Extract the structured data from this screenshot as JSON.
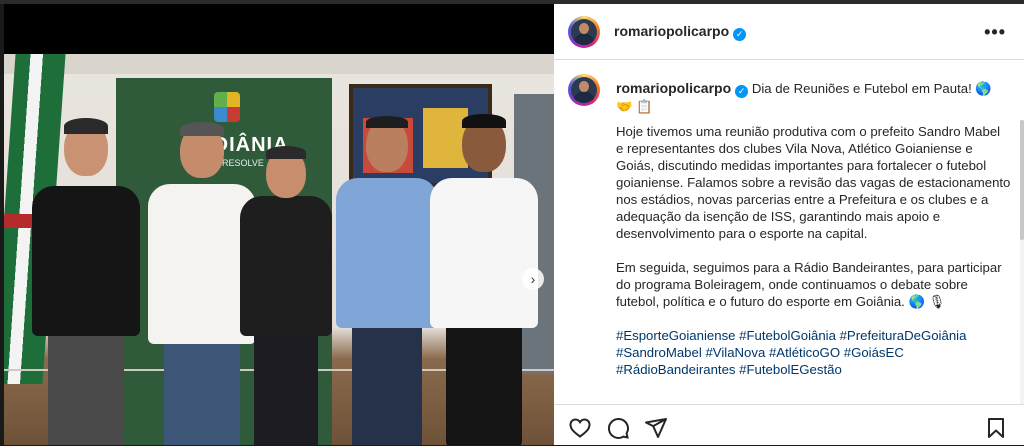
{
  "post": {
    "username": "romariopolicarpo",
    "caption_title": "Dia de Reuniões e Futebol em Pauta! 🌎 🤝 📋",
    "paragraphs": [
      "Hoje tivemos uma reunião produtiva com o prefeito Sandro Mabel e representantes dos clubes Vila Nova, Atlético Goianiense e Goiás, discutindo medidas importantes para fortalecer o futebol goianiense. Falamos sobre a revisão das vagas de estacionamento nos estádios, novas parcerias entre a Prefeitura e os clubes e a adequação da isenção de ISS, garantindo mais apoio e desenvolvimento para o esporte na capital.",
      "Em seguida, seguimos para a Rádio Bandeirantes, para participar do programa Boleiragem, onde continuamos o debate sobre futebol, política e o futuro do esporte em Goiânia. 🌎 🎙"
    ],
    "hashtags": "#EsporteGoianiense #FutebolGoiânia #PrefeituraDeGoiânia #SandroMabel #VilaNova #AtléticoGO #GoiásEC #RádioBandeirantes #FutebolEGestão"
  },
  "photo": {
    "banner_text": "GOIÂNIA",
    "banner_subtext": "QUE RESOLVE"
  },
  "icons": {
    "verified": "verified-badge-icon",
    "more": "more-options-icon",
    "like": "heart-icon",
    "comment": "comment-icon",
    "share": "send-icon",
    "save": "bookmark-icon",
    "carousel_next": "chevron-right-icon"
  },
  "colors": {
    "link": "#00376b",
    "verified": "#0095f6",
    "text": "#262626"
  }
}
